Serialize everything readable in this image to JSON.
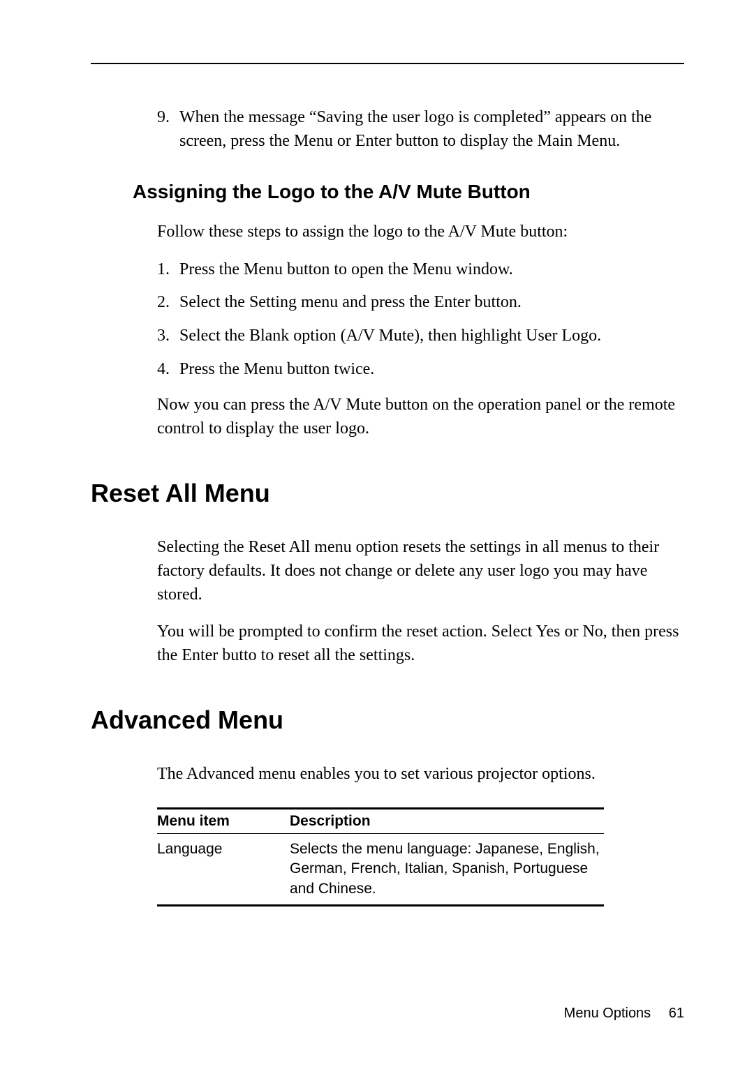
{
  "step9": {
    "num": "9.",
    "text": "When the message “Saving the user logo is completed” appears on the screen, press the Menu or Enter button to display the Main Menu."
  },
  "assign": {
    "heading": "Assigning the Logo to the A/V Mute Button",
    "intro": "Follow these steps to assign the logo to the A/V Mute button:",
    "steps": [
      {
        "num": "1.",
        "text": "Press the Menu button to open the Menu window."
      },
      {
        "num": "2.",
        "text": "Select the Setting menu and press the Enter button."
      },
      {
        "num": "3.",
        "text": "Select the Blank option (A/V Mute), then highlight User Logo."
      },
      {
        "num": "4.",
        "text": "Press the Menu button twice."
      }
    ],
    "after": "Now you can press the A/V Mute button on the operation panel or the remote control to display the user logo."
  },
  "reset": {
    "heading": "Reset All Menu",
    "p1": "Selecting the Reset All menu option resets the settings in all menus to their factory defaults. It does not change or delete any user logo you may have stored.",
    "p2": "You will be prompted to confirm the reset action. Select Yes or No, then press the Enter butto to reset all the settings."
  },
  "advanced": {
    "heading": "Advanced Menu",
    "intro": "The Advanced menu enables you to set various projector options.",
    "table": {
      "headers": {
        "col1": "Menu item",
        "col2": "Description"
      },
      "rows": [
        {
          "item": "Language",
          "desc": "Selects the menu language: Japanese, English, German, French, Italian, Spanish, Portuguese and Chinese."
        }
      ]
    }
  },
  "footer": {
    "section": "Menu Options",
    "page": "61"
  }
}
